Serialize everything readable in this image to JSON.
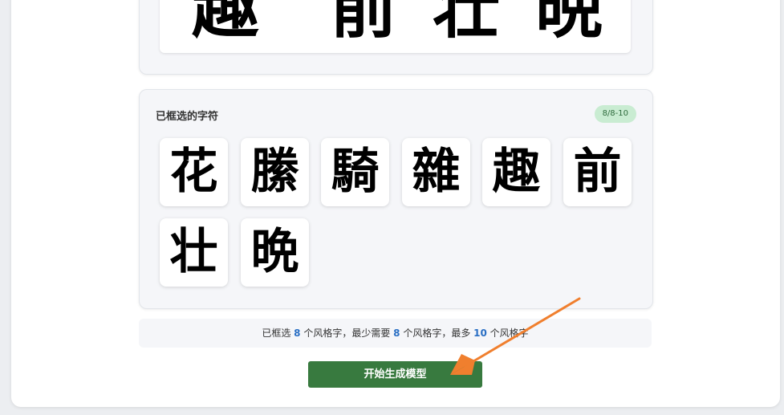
{
  "selected_panel": {
    "title": "已框选的字符",
    "count_badge": "8/8-10",
    "characters": [
      {
        "glyph": "花"
      },
      {
        "glyph": "縢"
      },
      {
        "glyph": "騎"
      },
      {
        "glyph": "雜"
      },
      {
        "glyph": "趣"
      },
      {
        "glyph": "前"
      },
      {
        "glyph": "壮"
      },
      {
        "glyph": "晩"
      }
    ]
  },
  "top_preview": {
    "glyphs": [
      "趣",
      "前",
      "壮",
      "晩"
    ]
  },
  "info": {
    "prefix": "已框选 ",
    "selected_count": "8",
    "middle1": " 个风格字，最少需要 ",
    "min_count": "8",
    "middle2": " 个风格字，最多 ",
    "max_count": "10",
    "suffix": " 个风格字"
  },
  "actions": {
    "start_label": "开始生成模型"
  },
  "colors": {
    "primary_button": "#387a3f",
    "badge_bg": "#c9ecd2",
    "highlight_number": "#2a6fc4",
    "arrow": "#f07f2e"
  },
  "icons": {
    "annotation": "orange-arrow-icon"
  }
}
